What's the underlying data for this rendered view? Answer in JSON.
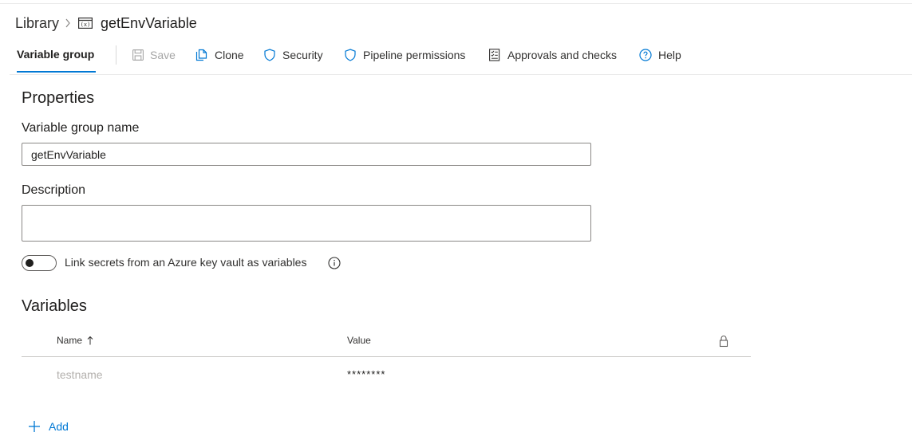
{
  "breadcrumb": {
    "library": "Library",
    "current": "getEnvVariable"
  },
  "toolbar": {
    "active_tab": "Variable group",
    "save": "Save",
    "clone": "Clone",
    "security": "Security",
    "pipeline_permissions": "Pipeline permissions",
    "approvals": "Approvals and checks",
    "help": "Help"
  },
  "properties": {
    "heading": "Properties",
    "name_label": "Variable group name",
    "name_value": "getEnvVariable",
    "description_label": "Description",
    "description_value": "",
    "keyvault_label": "Link secrets from an Azure key vault as variables",
    "keyvault_enabled": false
  },
  "variables": {
    "heading": "Variables",
    "columns": {
      "name": "Name",
      "value": "Value"
    },
    "rows": [
      {
        "name": "testname",
        "value": "********",
        "secret": true
      }
    ],
    "add_label": "Add"
  },
  "colors": {
    "accent": "#0078d4",
    "text": "#201f1e",
    "disabled": "#a6a6a6"
  }
}
